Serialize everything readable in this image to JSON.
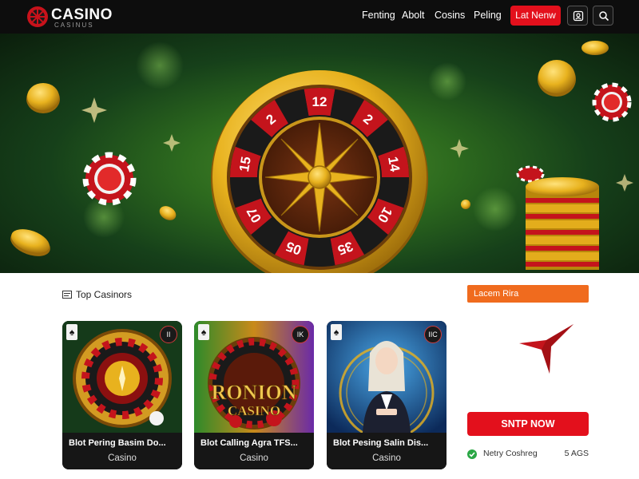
{
  "header": {
    "logo_title": "CASINO",
    "logo_sub": "CASINUS",
    "nav": [
      "Fenting",
      "Abolt",
      "Cosins",
      "Peling"
    ],
    "cta": "Lat Nenw",
    "icons": [
      "account-icon",
      "search-icon"
    ]
  },
  "hero": {
    "wheel_numbers": [
      "12",
      "2",
      "14",
      "10",
      "35",
      "05",
      "07",
      "15",
      "2"
    ]
  },
  "main": {
    "section_title": "Top Casinors",
    "cards": [
      {
        "name": "Blot Pering Basim Do...",
        "type": "Casino",
        "badge": "II",
        "suit": "♠"
      },
      {
        "name": "Blot Calling Agra TFS...",
        "type": "Casino",
        "badge": "IK",
        "suit": "♠",
        "art_text_1": "RONION",
        "art_text_2": "CASINO"
      },
      {
        "name": "Blot Pesing Salin Dis...",
        "type": "Casino",
        "badge": "IIC",
        "suit": "♠"
      }
    ],
    "side": {
      "pill": "Lacem Rira",
      "cta": "SNTP NOW",
      "row_label": "Netry Coshreg",
      "row_value": "5 AGS"
    }
  },
  "colors": {
    "accent_red": "#e3101c",
    "accent_orange": "#f06b1e",
    "header_bg": "#0d0d0d",
    "hero_green": "#2d6a1e",
    "gold": "#e8b21e",
    "check_green": "#2aa745"
  }
}
